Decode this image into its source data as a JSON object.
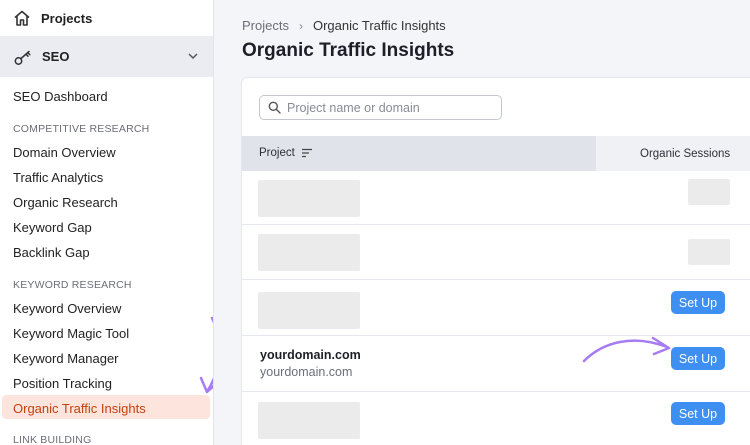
{
  "sidebar": {
    "projects_label": "Projects",
    "seo_label": "SEO",
    "dashboard": "SEO Dashboard",
    "section_competitive": "COMPETITIVE RESEARCH",
    "competitive_items": [
      "Domain Overview",
      "Traffic Analytics",
      "Organic Research",
      "Keyword Gap",
      "Backlink Gap"
    ],
    "section_keyword": "KEYWORD RESEARCH",
    "keyword_items": [
      "Keyword Overview",
      "Keyword Magic Tool",
      "Keyword Manager",
      "Position Tracking",
      "Organic Traffic Insights"
    ],
    "section_link": "LINK BUILDING"
  },
  "breadcrumb": {
    "root": "Projects",
    "current": "Organic Traffic Insights"
  },
  "page_title": "Organic Traffic Insights",
  "search": {
    "placeholder": "Project name or domain",
    "value": ""
  },
  "table": {
    "col_project": "Project",
    "col_sessions": "Organic Sessions",
    "setup_label": "Set Up",
    "domain_name": "yourdomain.com",
    "domain_sub": "yourdomain.com"
  },
  "colors": {
    "accent": "#3d8ff2",
    "active_bg": "#fde5dd",
    "active_text": "#c2410c",
    "annotation": "#a77cf0"
  }
}
